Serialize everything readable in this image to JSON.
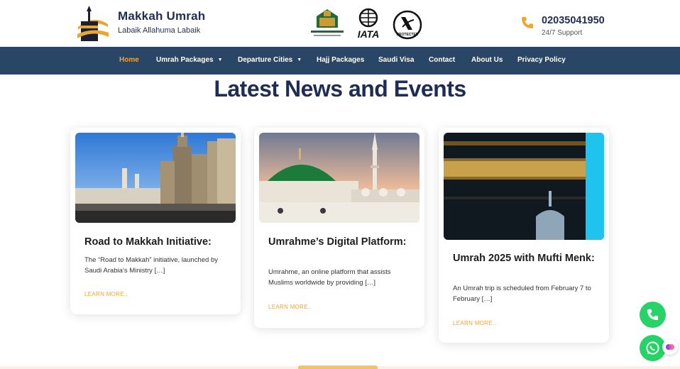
{
  "header": {
    "brand_title": "Makkah Umrah",
    "brand_tagline": "Labaik Allahuma Labaik",
    "partner_logos": [
      "ministry-of-hajj-logo",
      "iata-logo",
      "atol-protected-logo"
    ],
    "iata_text": "IATA",
    "atol_text": "PROTECTED",
    "phone": "02035041950",
    "support": "24/7 Support"
  },
  "nav": {
    "items": [
      {
        "label": "Home",
        "active": true
      },
      {
        "label": "Umrah Packages",
        "dropdown": true
      },
      {
        "label": "Departure Cities",
        "dropdown": true
      },
      {
        "label": "Hajj Packages"
      },
      {
        "label": "Saudi Visa"
      },
      {
        "label": "Contact"
      },
      {
        "label": "About Us"
      },
      {
        "label": "Privacy Policy"
      }
    ]
  },
  "main": {
    "section_title": "Latest News and Events",
    "cards": [
      {
        "title": "Road to Makkah Initiative:",
        "text": "The “Road to Makkah” initiative, launched by Saudi Arabia’s Ministry […]",
        "more": "LEARN MORE.."
      },
      {
        "title": "Umrahme’s Digital Platform:",
        "text": "Umrahme, an online platform that assists Muslims worldwide by providing […]",
        "more": "LEARN MORE.."
      },
      {
        "title": "Umrah 2025 with Mufti Menk:",
        "text": "An Umrah trip is scheduled from February 7 to February […]",
        "more": "LEARN MORE.."
      }
    ]
  },
  "colors": {
    "navy": "#1d2d55",
    "nav_bg": "#2a4666",
    "accent": "#f0a42c",
    "whatsapp": "#25d366"
  },
  "icons": [
    "phone-icon",
    "chevron-down-icon",
    "call-icon",
    "whatsapp-icon",
    "chat-bot-icon"
  ]
}
